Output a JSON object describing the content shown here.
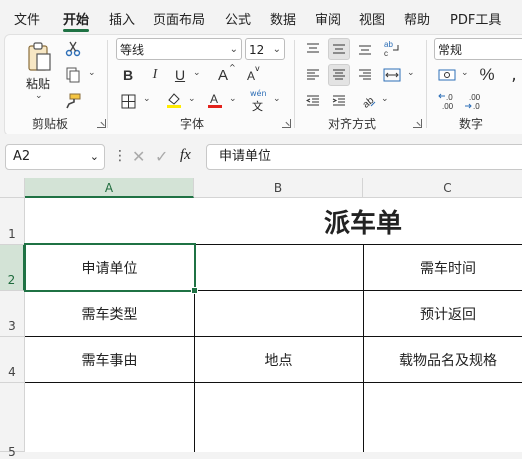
{
  "menu_tabs": [
    "文件",
    "开始",
    "插入",
    "页面布局",
    "公式",
    "数据",
    "审阅",
    "视图",
    "帮助",
    "PDF工具"
  ],
  "ribbon": {
    "clipboard": {
      "paste": "粘贴",
      "label": "剪贴板"
    },
    "font": {
      "name": "等线",
      "size": "12",
      "label": "字体",
      "bold": "B",
      "italic": "I",
      "underline": "U",
      "grow": "A",
      "shrink": "A",
      "phonetic": "wén"
    },
    "alignment": {
      "label": "对齐方式"
    },
    "number": {
      "format": "常规",
      "percent": "%",
      "label": "数字",
      "inc_decimal": ".00",
      "dec_decimal": ".00"
    }
  },
  "formula_bar": {
    "namebox": "A2",
    "fx": "fx",
    "content": "申请单位"
  },
  "sheet": {
    "columns": [
      "A",
      "B",
      "C"
    ],
    "rows": [
      "1",
      "2",
      "3",
      "4",
      "5"
    ],
    "title": "派车单",
    "cells": {
      "a2": "申请单位",
      "c2": "需车时间",
      "a3": "需车类型",
      "c3": "预计返回",
      "a4": "需车事由",
      "b4": "地点",
      "c4": "载物品名及规格"
    }
  },
  "colors": {
    "accent": "#1f7244",
    "font_color": "#e3221c",
    "highlight": "#ffeb00"
  }
}
